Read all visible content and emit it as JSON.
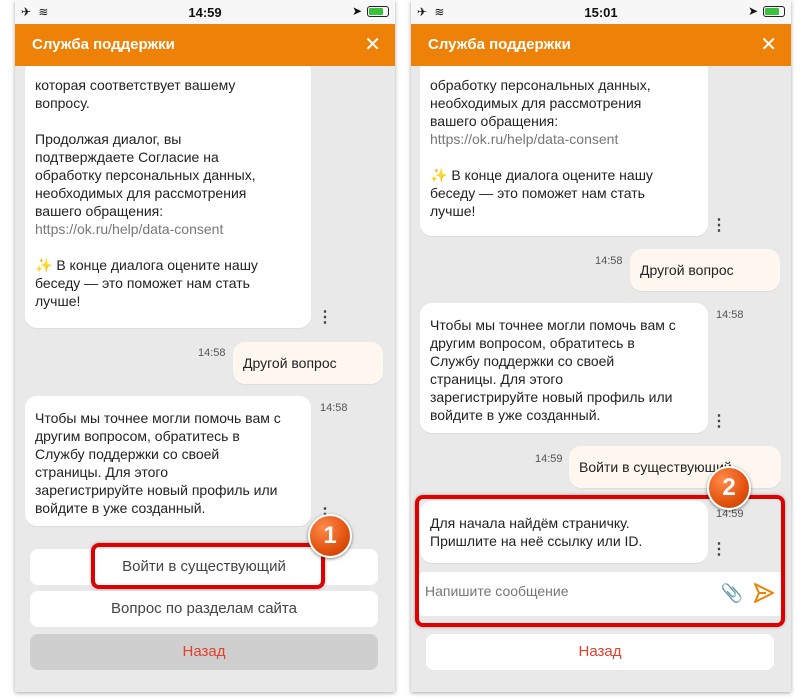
{
  "screen1": {
    "status": {
      "time": "14:59"
    },
    "header": {
      "title": "Служба поддержки",
      "close": "✕"
    },
    "messages": [
      {
        "lines": "которая соответствует вашему\nвопросу.\n\nПродолжая диалог, вы\nподтверждаете Согласие на\nобработку персональных данных,\nнеобходимых для рассмотрения\nвашего обращения:",
        "link": "https://ok.ru/help/data-consent",
        "tail": "В конце диалога оцените нашу\nбеседу — это поможет нам стать\nлучше!"
      },
      {
        "time": "14:58",
        "text": "Другой вопрос"
      },
      {
        "time": "14:58",
        "text": "Чтобы мы точнее могли помочь вам с\nдругим вопросом, обратитесь в\nСлужбу поддержки со своей\nстраницы. Для этого\nзарегистрируйте новый профиль или\nвойдите в уже созданный."
      }
    ],
    "buttons": {
      "login_existing": "Войти в существующий",
      "site_sections": "Вопрос по разделам сайта",
      "back": "Назад"
    },
    "badge": "1"
  },
  "screen2": {
    "status": {
      "time": "15:01"
    },
    "header": {
      "title": "Служба поддержки",
      "close": "✕"
    },
    "messages": [
      {
        "lines": "обработку персональных данных,\nнеобходимых для рассмотрения\nвашего обращения:",
        "link": "https://ok.ru/help/data-consent",
        "tail": "В конце диалога оцените нашу\nбеседу — это поможет нам стать\nлучше!"
      },
      {
        "time": "14:58",
        "text": "Другой вопрос"
      },
      {
        "time": "14:58",
        "text": "Чтобы мы точнее могли помочь вам с\nдругим вопросом, обратитесь в\nСлужбу поддержки со своей\nстраницы. Для этого\nзарегистрируйте новый профиль или\nвойдите в уже созданный."
      },
      {
        "time": "14:59",
        "text": "Войти в существующий"
      },
      {
        "time": "14:59",
        "text": "Для начала найдём страничку.\nПришлите на неё ссылку или ID."
      }
    ],
    "input": {
      "placeholder": "Напишите сообщение"
    },
    "buttons": {
      "back": "Назад"
    },
    "badge": "2"
  },
  "colors": {
    "header": "#ee8208",
    "highlight": "#e00000",
    "back_text": "#e2412b",
    "send": "#ee8208"
  }
}
